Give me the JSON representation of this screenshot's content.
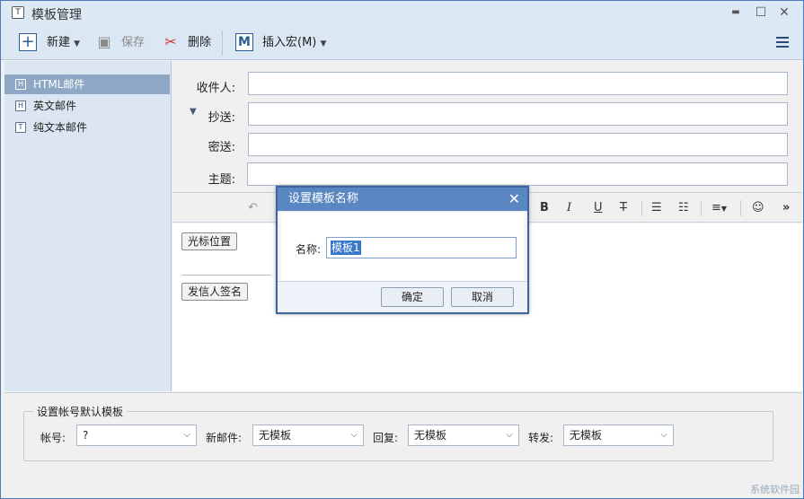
{
  "window": {
    "title": "模板管理",
    "minimize": "▬",
    "maximize": "☐",
    "close": "✕"
  },
  "toolbar": {
    "new_label": "新建",
    "save_label": "保存",
    "delete_label": "删除",
    "insert_macro_label": "插入宏(M)",
    "macro_icon_text": "M"
  },
  "tree": {
    "items": [
      {
        "icon": "H",
        "label": "HTML邮件",
        "selected": true
      },
      {
        "icon": "H",
        "label": "英文邮件",
        "selected": false
      },
      {
        "icon": "T",
        "label": "纯文本邮件",
        "selected": false
      }
    ]
  },
  "form": {
    "to_label": "收件人:",
    "cc_label": "抄送:",
    "bcc_label": "密送:",
    "subject_label": "主题:"
  },
  "editor": {
    "cursor_button": "光标位置",
    "signature_button": "发信人签名"
  },
  "bottom": {
    "group_title": "设置帐号默认模板",
    "account_label": "帐号:",
    "account_value": "?",
    "new_mail_label": "新邮件:",
    "new_mail_value": "无模板",
    "reply_label": "回复:",
    "reply_value": "无模板",
    "forward_label": "转发:",
    "forward_value": "无模板"
  },
  "dialog": {
    "title": "设置模板名称",
    "name_label": "名称:",
    "name_value": "模板1",
    "ok_label": "确定",
    "cancel_label": "取消"
  },
  "watermark": "系统软件园"
}
